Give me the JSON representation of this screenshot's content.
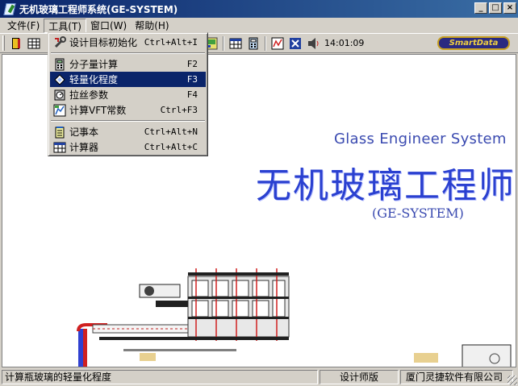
{
  "window": {
    "title": "无机玻璃工程师系统(GE-SYSTEM)",
    "min_label": "_",
    "max_label": "□",
    "close_label": "×"
  },
  "menubar": {
    "items": [
      {
        "label": "文件(F)"
      },
      {
        "label": "工具(T)"
      },
      {
        "label": "窗口(W)"
      },
      {
        "label": "帮助(H)"
      }
    ]
  },
  "toolbar": {
    "time": "14:01:09",
    "smartdata_label": "SmartData",
    "icons": [
      "exit-icon",
      "grid-icon",
      "grid-icon",
      "calc-icon",
      "chart-icon",
      "config-icon",
      "speaker-icon"
    ]
  },
  "tools_menu": {
    "items": [
      {
        "label": "设计目标初始化",
        "shortcut": "Ctrl+Alt+I",
        "icon": "tools-icon"
      },
      {
        "label": "分子量计算",
        "shortcut": "F2",
        "icon": "calculator-icon"
      },
      {
        "label": "轻量化程度",
        "shortcut": "F3",
        "icon": "lightweight-icon",
        "highlighted": true
      },
      {
        "label": "拉丝参数",
        "shortcut": "F4",
        "icon": "drawing-icon"
      },
      {
        "label": "计算VFT常数",
        "shortcut": "Ctrl+F3",
        "icon": "vft-icon"
      },
      {
        "label": "记事本",
        "shortcut": "Ctrl+Alt+N",
        "icon": "notepad-icon"
      },
      {
        "label": "计算器",
        "shortcut": "Ctrl+Alt+C",
        "icon": "calculator2-icon"
      }
    ]
  },
  "splash": {
    "title_en": "Glass Engineer System",
    "title_cn": "无机玻璃工程师",
    "subtitle": "(GE-SYSTEM)"
  },
  "statusbar": {
    "message": "计算瓶玻璃的轻量化程度",
    "role": "设计师版",
    "company": "厦门灵捷软件有限公司"
  },
  "colors": {
    "title_bg": "#0a246a",
    "highlight": "#0a246a",
    "splash_text": "#2a40d0"
  }
}
